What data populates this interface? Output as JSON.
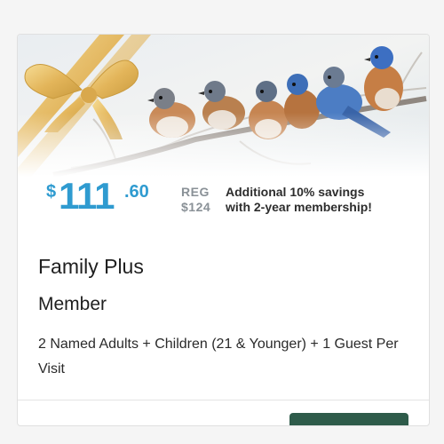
{
  "offer": {
    "currency_symbol": "$",
    "price_whole": "111",
    "price_cents": ".60",
    "reg_label": "REG",
    "reg_price": "$124",
    "savings_line1": "Additional 10% savings",
    "savings_line2": "with 2-year membership!"
  },
  "membership": {
    "title": "Family Plus",
    "subtitle": "Member",
    "description": "2 Named Adults + Children (21 & Younger) + 1 Guest Per Visit"
  },
  "colors": {
    "price_blue": "#2f9bd0",
    "button_green": "#2e5b4a",
    "ribbon_gold": "#e0b95a"
  }
}
